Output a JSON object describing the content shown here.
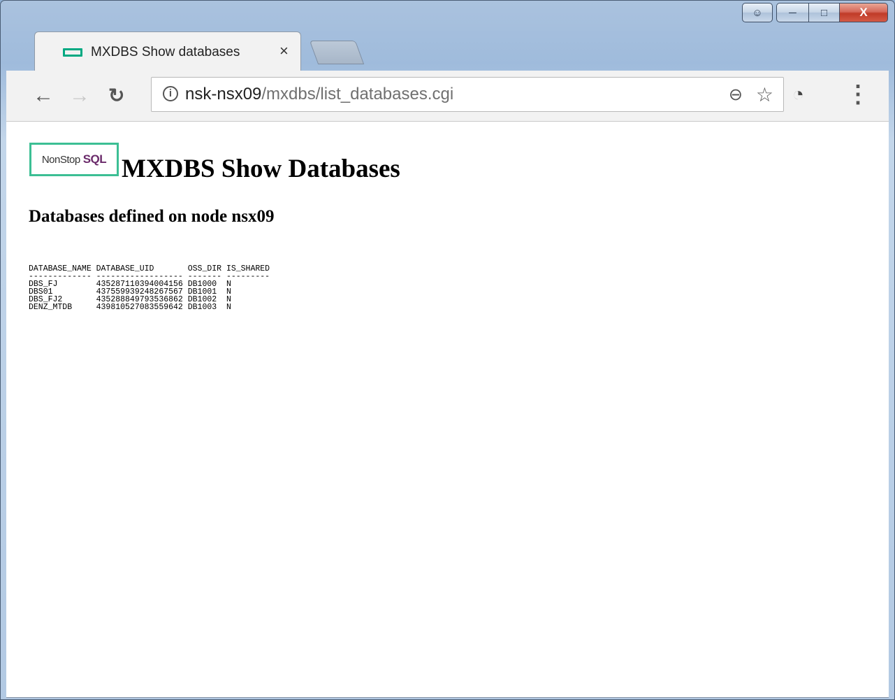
{
  "window": {
    "close_glyph": "X"
  },
  "tab": {
    "title": "MXDBS Show databases",
    "close_glyph": "×"
  },
  "toolbar": {
    "url_host": "nsk-nsx09",
    "url_path": "/mxdbs/list_databases.cgi"
  },
  "page": {
    "logo_text": "NonStop",
    "logo_sql": "SQL",
    "title": "MXDBS Show Databases",
    "subtitle": "Databases defined on node nsx09",
    "table": {
      "columns": [
        "DATABASE_NAME",
        "DATABASE_UID",
        "OSS_DIR",
        "IS_SHARED"
      ],
      "rows": [
        [
          "DBS_FJ",
          "435287110394004156",
          "DB1000",
          "N"
        ],
        [
          "DBS01",
          "437559939248267567",
          "DB1001",
          "N"
        ],
        [
          "DBS_FJ2",
          "435288849793536862",
          "DB1002",
          "N"
        ],
        [
          "DENZ_MTDB",
          "439810527083559642",
          "DB1003",
          "N"
        ]
      ]
    }
  },
  "colors": {
    "accent": "#01a982",
    "close_button": "#c03b28",
    "url_path": "#707070"
  }
}
